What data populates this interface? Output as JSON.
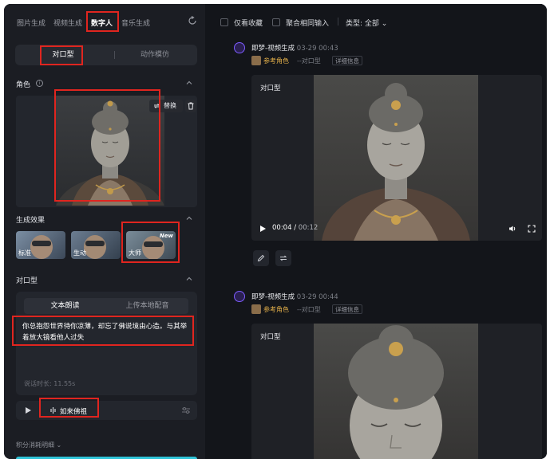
{
  "left_panel": {
    "nav_tabs": [
      "图片生成",
      "视频生成",
      "数字人",
      "音乐生成"
    ],
    "sub_tabs": [
      "对口型",
      "动作模仿"
    ],
    "role_section": {
      "title": "角色",
      "replace_label": "替换"
    },
    "effect_section": {
      "title": "生成效果",
      "options": [
        "标准",
        "生动",
        "大师"
      ],
      "new_badge": "New"
    },
    "lipsync_section": {
      "title": "对口型",
      "tabs": [
        "文本朗读",
        "上传本地配音"
      ],
      "script": "你总抱怨世界待你凉薄，却忘了佛说境由心造。与其举着放大镜看他人过失",
      "duration": "说话时长: 11.55s"
    },
    "voice": {
      "name": "如来佛祖"
    },
    "credits_label": "积分消耗明细"
  },
  "right_panel": {
    "filters": {
      "favorites_label": "仅看收藏",
      "merge_label": "聚合相同输入",
      "type_label": "类型: 全部"
    },
    "cards": [
      {
        "title": "即梦-视频生成",
        "time": "03-29  00:43",
        "ref_label": "参考角色",
        "type_label": "--对口型",
        "detail_label": "详细信息",
        "video_tag": "对口型",
        "current_time": "00:04",
        "total_time": "00:12"
      },
      {
        "title": "即梦-视频生成",
        "time": "03-29  00:44",
        "ref_label": "参考角色",
        "type_label": "--对口型",
        "detail_label": "详细信息",
        "video_tag": "对口型"
      }
    ]
  },
  "colors": {
    "highlight": "#e0251f",
    "accent_purple": "#7d5cff",
    "ref_gold": "#e7b24a",
    "cta": "#2fc4d8"
  }
}
